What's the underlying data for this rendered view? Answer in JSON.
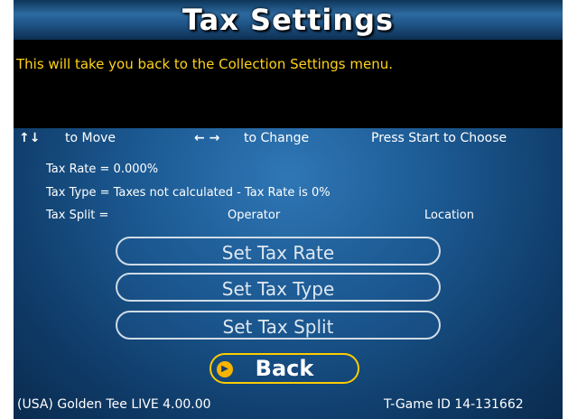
{
  "header": {
    "title": "Tax Settings"
  },
  "message": "This will take you back to the Collection Settings menu.",
  "hints": {
    "move_icon": "↑↓",
    "move_label": "to Move",
    "change_icon": "← →",
    "change_label": "to Change",
    "choose_label": "Press Start to Choose"
  },
  "info": {
    "tax_rate": "Tax Rate = 0.000%",
    "tax_type": "Tax Type = Taxes not calculated - Tax Rate is 0%",
    "tax_split_label": "Tax Split =",
    "tax_split_operator": "Operator",
    "tax_split_location": "Location"
  },
  "menu": {
    "items": [
      "Set Tax Rate",
      "Set Tax Type",
      "Set Tax Split"
    ],
    "back": "Back"
  },
  "footer": {
    "version": "(USA) Golden Tee LIVE 4.00.00",
    "game_id": "T-Game ID 14-131662"
  },
  "colors": {
    "message_text": "#ffd21a",
    "selected_border": "#ffcc00",
    "background": "#1c5a93"
  }
}
